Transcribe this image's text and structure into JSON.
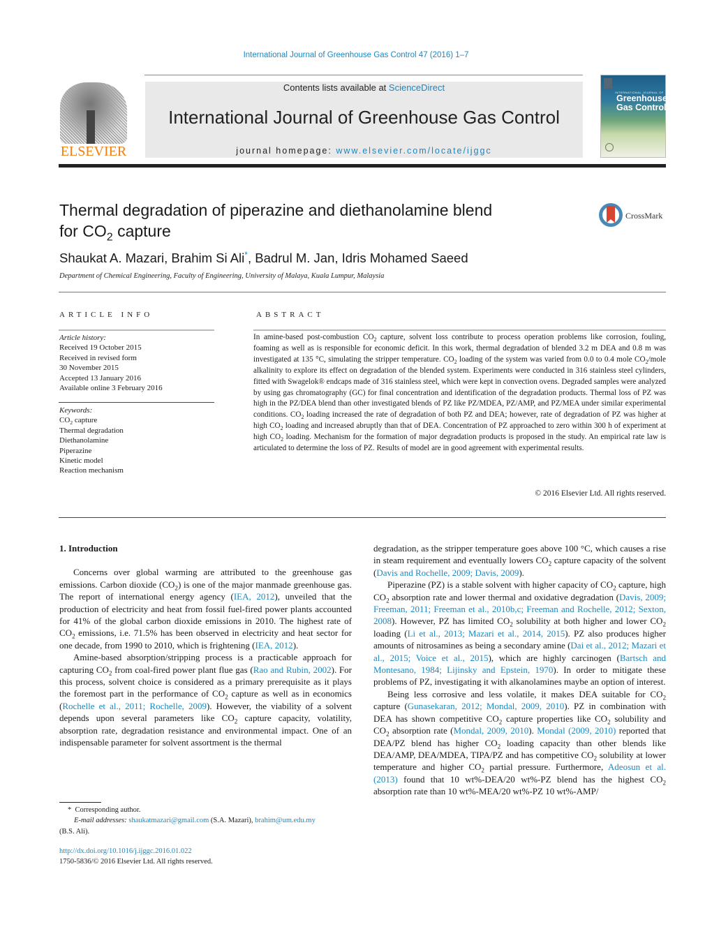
{
  "header": {
    "journal_ref": "International Journal of Greenhouse Gas Control 47 (2016) 1–7",
    "contents_prefix": "Contents lists available at ",
    "contents_link": "ScienceDirect",
    "journal_title": "International Journal of Greenhouse Gas Control",
    "homepage_prefix": "journal homepage: ",
    "homepage_link": "www.elsevier.com/locate/ijggc",
    "publisher_logo": "ELSEVIER",
    "cover": {
      "small": "INTERNATIONAL JOURNAL OF",
      "title_line1": "Greenhouse",
      "title_line2": "Gas Control"
    },
    "crossmark_label": "CrossMark"
  },
  "article": {
    "title_line1": "Thermal degradation of piperazine and diethanolamine blend",
    "title_line2_pre": "for CO",
    "title_line2_sub": "2",
    "title_line2_post": " capture",
    "authors_pre": "Shaukat A. Mazari, Brahim Si Ali",
    "authors_star": "*",
    "authors_post": ", Badrul M. Jan, Idris Mohamed Saeed",
    "affiliation": "Department of Chemical Engineering, Faculty of Engineering, University of Malaya, Kuala Lumpur, Malaysia"
  },
  "article_info": {
    "heading": "ARTICLE INFO",
    "history_label": "Article history:",
    "history": [
      "Received 19 October 2015",
      "Received in revised form",
      "30 November 2015",
      "Accepted 13 January 2016",
      "Available online 3 February 2016"
    ],
    "keywords_label": "Keywords:",
    "keywords": [
      "CO₂ capture",
      "Thermal degradation",
      "Diethanolamine",
      "Piperazine",
      "Kinetic model",
      "Reaction mechanism"
    ]
  },
  "abstract": {
    "heading": "ABSTRACT",
    "text": "In amine-based post-combustion CO₂ capture, solvent loss contribute to process operation problems like corrosion, fouling, foaming as well as is responsible for economic deficit. In this work, thermal degradation of blended 3.2 m DEA and 0.8 m was investigated at 135 °C, simulating the stripper temperature. CO₂ loading of the system was varied from 0.0 to 0.4 mole CO₂/mole alkalinity to explore its effect on degradation of the blended system. Experiments were conducted in 316 stainless steel cylinders, fitted with Swagelok® endcaps made of 316 stainless steel, which were kept in convection ovens. Degraded samples were analyzed by using gas chromatography (GC) for final concentration and identification of the degradation products. Thermal loss of PZ was high in the PZ/DEA blend than other investigated blends of PZ like PZ/MDEA, PZ/AMP, and PZ/MEA under similar experimental conditions. CO₂ loading increased the rate of degradation of both PZ and DEA; however, rate of degradation of PZ was higher at high CO₂ loading and increased abruptly than that of DEA. Concentration of PZ approached to zero within 300 h of experiment at high CO₂ loading. Mechanism for the formation of major degradation products is proposed in the study. An empirical rate law is articulated to determine the loss of PZ. Results of model are in good agreement with experimental results.",
    "copyright": "© 2016 Elsevier Ltd. All rights reserved."
  },
  "body": {
    "section_title": "1.  Introduction",
    "left": [
      [
        {
          "t": "Concerns over global warming are attributed to the greenhouse gas emissions. Carbon dioxide (CO₂) is one of the major manmade greenhouse gas. The report of international energy agency ("
        },
        {
          "l": "IEA, 2012"
        },
        {
          "t": "), unveiled that the production of electricity and heat from fossil fuel-fired power plants accounted for 41% of the global carbon dioxide emissions in 2010. The highest rate of CO₂ emissions, i.e. 71.5% has been observed in electricity and heat sector for one decade, from 1990 to 2010, which is frightening ("
        },
        {
          "l": "IEA, 2012"
        },
        {
          "t": ")."
        }
      ],
      [
        {
          "t": "Amine-based absorption/stripping process is a practicable approach for capturing CO₂ from coal-fired power plant flue gas ("
        },
        {
          "l": "Rao and Rubin, 2002"
        },
        {
          "t": "). For this process, solvent choice is considered as a primary prerequisite as it plays the foremost part in the performance of CO₂ capture as well as in economics ("
        },
        {
          "l": "Rochelle et al., 2011; Rochelle, 2009"
        },
        {
          "t": "). However, the viability of a solvent depends upon several parameters like CO₂ capture capacity, volatility, absorption rate, degradation resistance and environmental impact. One of an indispensable parameter for solvent assortment is the thermal"
        }
      ]
    ],
    "right": [
      [
        {
          "t": "degradation, as the stripper temperature goes above 100 °C, which causes a rise in steam requirement and eventually lowers CO₂ capture capacity of the solvent ("
        },
        {
          "l": "Davis and Rochelle, 2009; Davis, 2009"
        },
        {
          "t": ")."
        }
      ],
      [
        {
          "t": "Piperazine (PZ) is a stable solvent with higher capacity of CO₂ capture, high CO₂ absorption rate and lower thermal and oxidative degradation ("
        },
        {
          "l": "Davis, 2009; Freeman, 2011; Freeman et al., 2010b,c; Freeman and Rochelle, 2012; Sexton, 2008"
        },
        {
          "t": "). However, PZ has limited CO₂ solubility at both higher and lower CO₂ loading ("
        },
        {
          "l": "Li et al., 2013; Mazari et al., 2014, 2015"
        },
        {
          "t": "). PZ also produces higher amounts of nitrosamines as being a secondary amine ("
        },
        {
          "l": "Dai et al., 2012; Mazari et al., 2015; Voice et al., 2015"
        },
        {
          "t": "), which are highly carcinogen ("
        },
        {
          "l": "Bartsch and Montesano, 1984; Lijinsky and Epstein, 1970"
        },
        {
          "t": "). In order to mitigate these problems of PZ, investigating it with alkanolamines maybe an option of interest."
        }
      ],
      [
        {
          "t": "Being less corrosive and less volatile, it makes DEA suitable for CO₂ capture ("
        },
        {
          "l": "Gunasekaran, 2012; Mondal, 2009, 2010"
        },
        {
          "t": "). PZ in combination with DEA has shown competitive CO₂ capture properties like CO₂ solubility and CO₂ absorption rate ("
        },
        {
          "l": "Mondal, 2009, 2010"
        },
        {
          "t": "). "
        },
        {
          "l": "Mondal (2009, 2010)"
        },
        {
          "t": " reported that DEA/PZ blend has higher CO₂ loading capacity than other blends like DEA/AMP, DEA/MDEA, TIPA/PZ and has competitive CO₂ solubility at lower temperature and higher CO₂ partial pressure. Furthermore, "
        },
        {
          "l": "Adeosun et al. (2013)"
        },
        {
          "t": " found that 10 wt%-DEA/20 wt%-PZ blend has the highest CO₂ absorption rate than 10 wt%-MEA/20 wt%-PZ 10 wt%-AMP/"
        }
      ]
    ]
  },
  "footnote": {
    "star": "*",
    "corresponding": "Corresponding author.",
    "email_label": "E-mail addresses:",
    "email1": "shaukatmazari@gmail.com",
    "email1_name": " (S.A. Mazari), ",
    "email2": "brahim@um.edu.my",
    "email2_name": "(B.S. Ali).",
    "doi": "http://dx.doi.org/10.1016/j.ijggc.2016.01.022",
    "issn": "1750-5836/© 2016 Elsevier Ltd. All rights reserved."
  },
  "colors": {
    "link": "#1b88c1",
    "elsevier_orange": "#f07f12",
    "masthead_bg": "#e9e9e9"
  }
}
